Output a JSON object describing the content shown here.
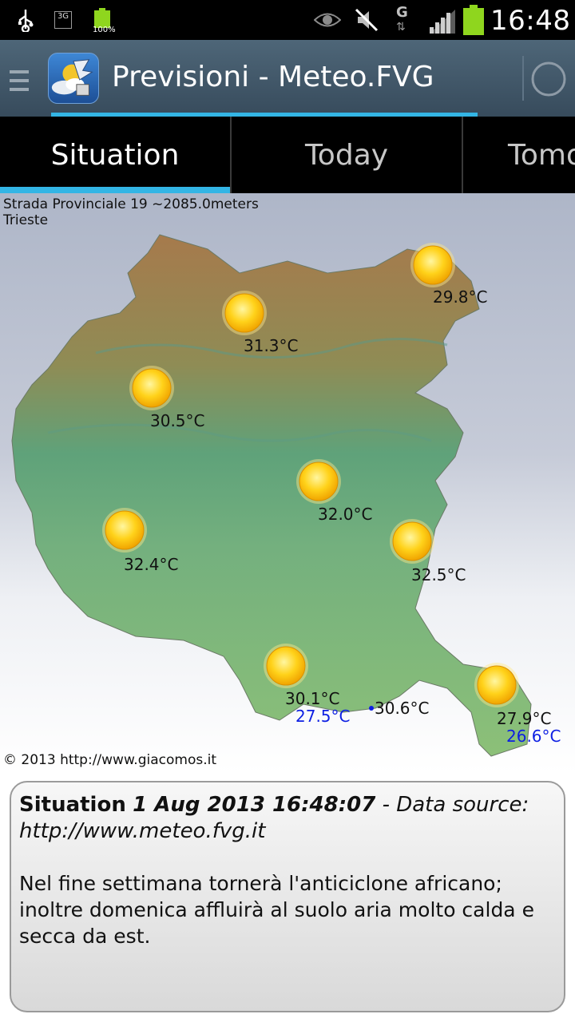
{
  "status_bar": {
    "time": "16:48",
    "network_badge": "3G",
    "battery_percent_label": "100%",
    "data_label": "G",
    "icons": [
      "usb-icon",
      "network-3g-icon",
      "battery-charged-icon",
      "eye-icon",
      "mute-icon",
      "data-arrows-icon",
      "signal-icon",
      "battery-icon"
    ]
  },
  "action_bar": {
    "title": "Previsioni - Meteo.FVG",
    "icons": [
      "menu-icon",
      "app-logo-icon",
      "refresh-icon"
    ]
  },
  "tabs": [
    {
      "label": "Situation",
      "selected": true
    },
    {
      "label": "Today",
      "selected": false
    },
    {
      "label": "Tomorrow",
      "selected": false
    }
  ],
  "map": {
    "location_line1": "Strada Provinciale 19  ~2085.0meters",
    "location_line2": "Trieste",
    "copyright": "© 2013 http://www.giacomos.it",
    "stations": [
      {
        "temp": "29.8°C",
        "icon": "sun-icon"
      },
      {
        "temp": "31.3°C",
        "icon": "sun-icon"
      },
      {
        "temp": "30.5°C",
        "icon": "sun-icon"
      },
      {
        "temp": "32.0°C",
        "icon": "sun-icon"
      },
      {
        "temp": "32.4°C",
        "icon": "sun-icon"
      },
      {
        "temp": "32.5°C",
        "icon": "sun-icon"
      },
      {
        "temp": "30.1°C",
        "sea_temp": "27.5°C",
        "icon": "sun-icon"
      },
      {
        "temp": "30.6°C",
        "icon": "dot"
      },
      {
        "temp": "27.9°C",
        "sea_temp": "26.6°C",
        "icon": "sun-icon"
      }
    ],
    "colors": {
      "air_temp": "#111111",
      "sea_temp": "#0d1fe3"
    }
  },
  "panel": {
    "heading": "Situation",
    "timestamp": "1 Aug 2013 16:48:07",
    "source": " - Data source: http://www.meteo.fvg.it",
    "text": "Nel fine settimana tornerà l'anticiclone africano; inoltre domenica affluirà al suolo aria molto calda e secca da est."
  },
  "accent_color": "#33b5e5"
}
